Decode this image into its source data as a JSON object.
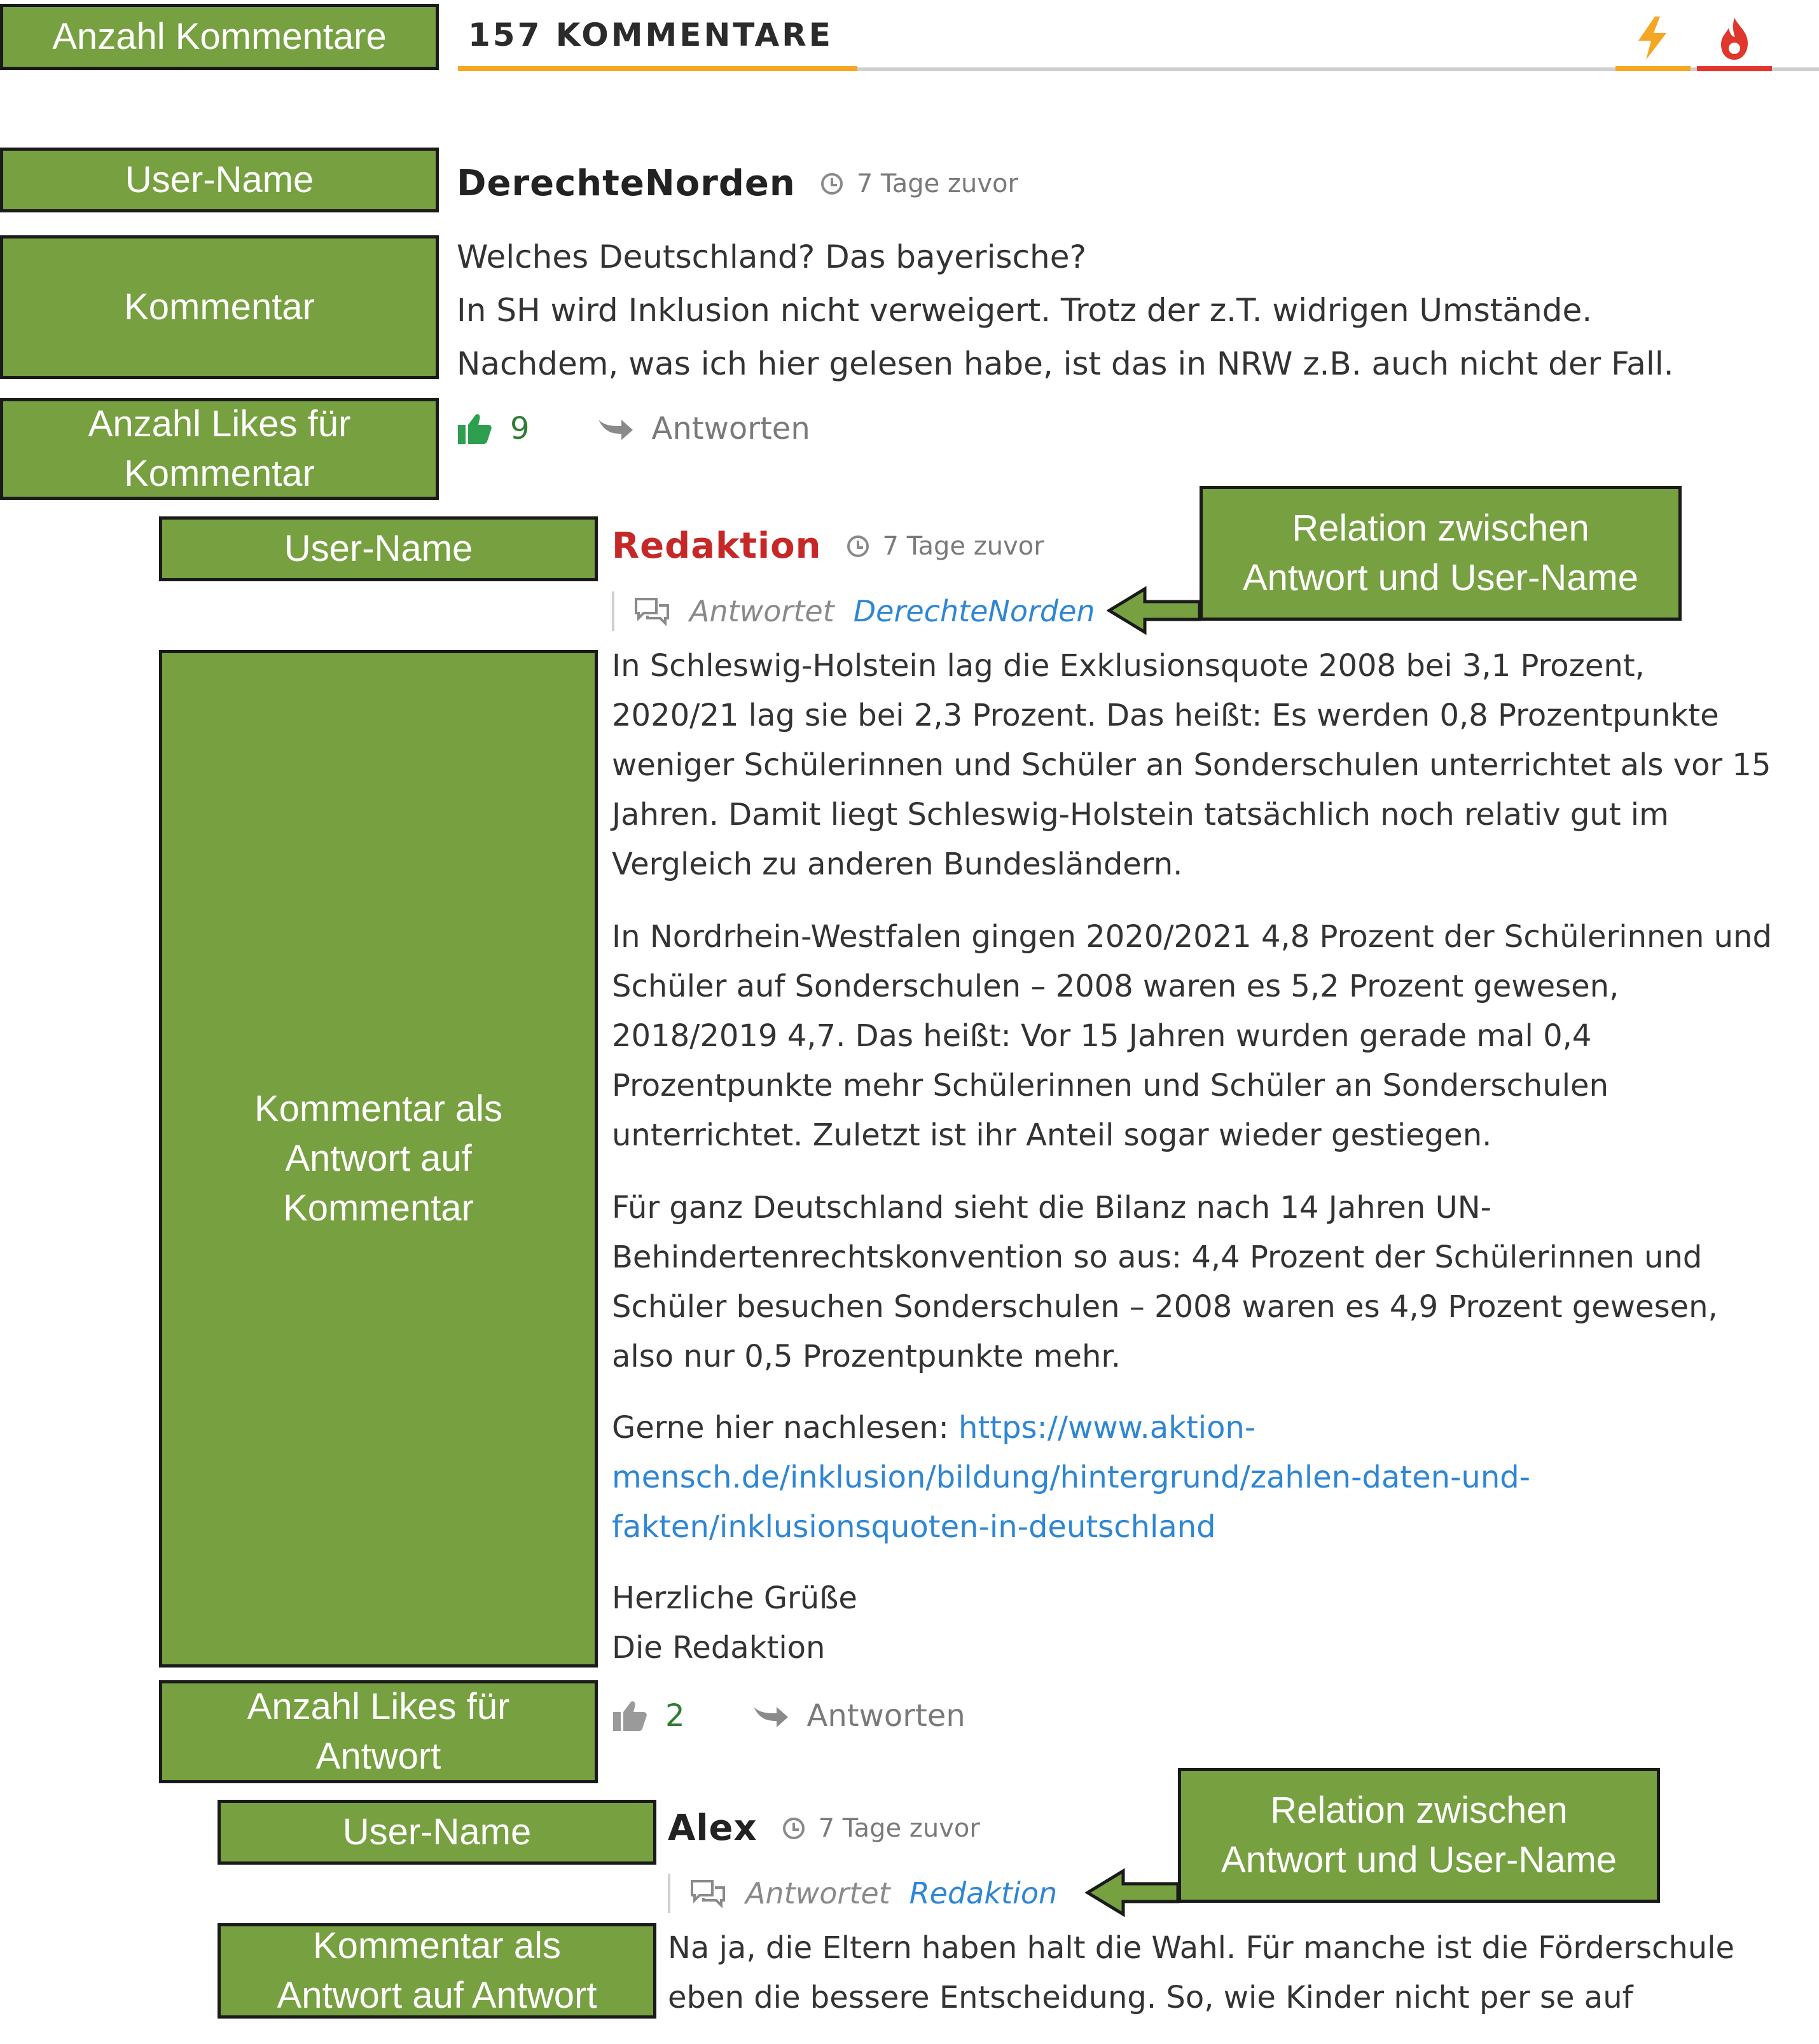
{
  "annotations": {
    "anzahl_kommentare": "Anzahl Kommentare",
    "user_name_1": "User-Name",
    "kommentar": "Kommentar",
    "likes_kommentar": [
      "Anzahl Likes für",
      "Kommentar"
    ],
    "user_name_2": "User-Name",
    "relation_1": [
      "Relation zwischen",
      "Antwort und User-Name"
    ],
    "antwort_auf_kommentar": [
      "Kommentar als",
      "Antwort auf",
      "Kommentar"
    ],
    "likes_antwort": [
      "Anzahl Likes für",
      "Antwort"
    ],
    "user_name_3": "User-Name",
    "relation_2": [
      "Relation zwischen",
      "Antwort und User-Name"
    ],
    "antwort_auf_antwort": [
      "Kommentar als",
      "Antwort auf Antwort"
    ]
  },
  "header": {
    "comment_count": "157 KOMMENTARE",
    "accent_color": "#f5a623",
    "hot_color": "#e0362b",
    "icons": [
      "lightning-icon",
      "flame-icon"
    ]
  },
  "comments": [
    {
      "user": "DerechteNorden",
      "time": "7 Tage zuvor",
      "lines": [
        "Welches Deutschland? Das bayerische?",
        "In SH wird Inklusion nicht verweigert. Trotz der z.T. widrigen Umstände.",
        "Nachdem, was ich hier gelesen habe, ist das in NRW z.B. auch nicht der Fall."
      ],
      "likes": "9",
      "reply_label": "Antworten"
    },
    {
      "user": "Redaktion",
      "user_color": "#c62828",
      "time": "7 Tage zuvor",
      "reply_prefix": "Antwortet",
      "reply_to": "DerechteNorden",
      "paragraphs": [
        [
          "In Schleswig-Holstein lag die Exklusionsquote 2008 bei 3,1 Prozent,",
          "2020/21 lag sie bei 2,3 Prozent. Das heißt: Es werden 0,8 Prozentpunkte",
          "weniger Schülerinnen und Schüler an Sonderschulen unterrichtet als vor 15",
          "Jahren. Damit liegt Schleswig-Holstein tatsächlich noch relativ gut im",
          "Vergleich zu anderen Bundesländern."
        ],
        [
          "In Nordrhein-Westfalen gingen 2020/2021 4,8 Prozent der Schülerinnen und",
          "Schüler auf Sonderschulen – 2008 waren es 5,2 Prozent gewesen,",
          "2018/2019 4,7. Das heißt: Vor 15 Jahren wurden gerade mal 0,4",
          "Prozentpunkte mehr Schülerinnen und Schüler an Sonderschulen",
          "unterrichtet. Zuletzt ist ihr Anteil sogar wieder gestiegen."
        ],
        [
          "Für ganz Deutschland sieht die Bilanz nach 14 Jahren UN-",
          "Behindertenrechtskonvention so aus: 4,4 Prozent der Schülerinnen und",
          "Schüler besuchen Sonderschulen – 2008 waren es 4,9 Prozent gewesen,",
          "also nur 0,5 Prozentpunkte mehr."
        ]
      ],
      "link_prefix": "Gerne hier nachlesen: ",
      "link_lines": [
        "https://www.aktion-",
        "mensch.de/inklusion/bildung/hintergrund/zahlen-daten-und-",
        "fakten/inklusionsquoten-in-deutschland"
      ],
      "signoff": [
        "Herzliche Grüße",
        "Die Redaktion"
      ],
      "likes": "2",
      "reply_label": "Antworten"
    },
    {
      "user": "Alex",
      "time": "7 Tage zuvor",
      "reply_prefix": "Antwortet",
      "reply_to": "Redaktion",
      "lines": [
        "Na ja, die Eltern haben halt die Wahl. Für manche ist die Förderschule",
        "eben die bessere Entscheidung. So, wie Kinder nicht per se auf"
      ]
    }
  ]
}
